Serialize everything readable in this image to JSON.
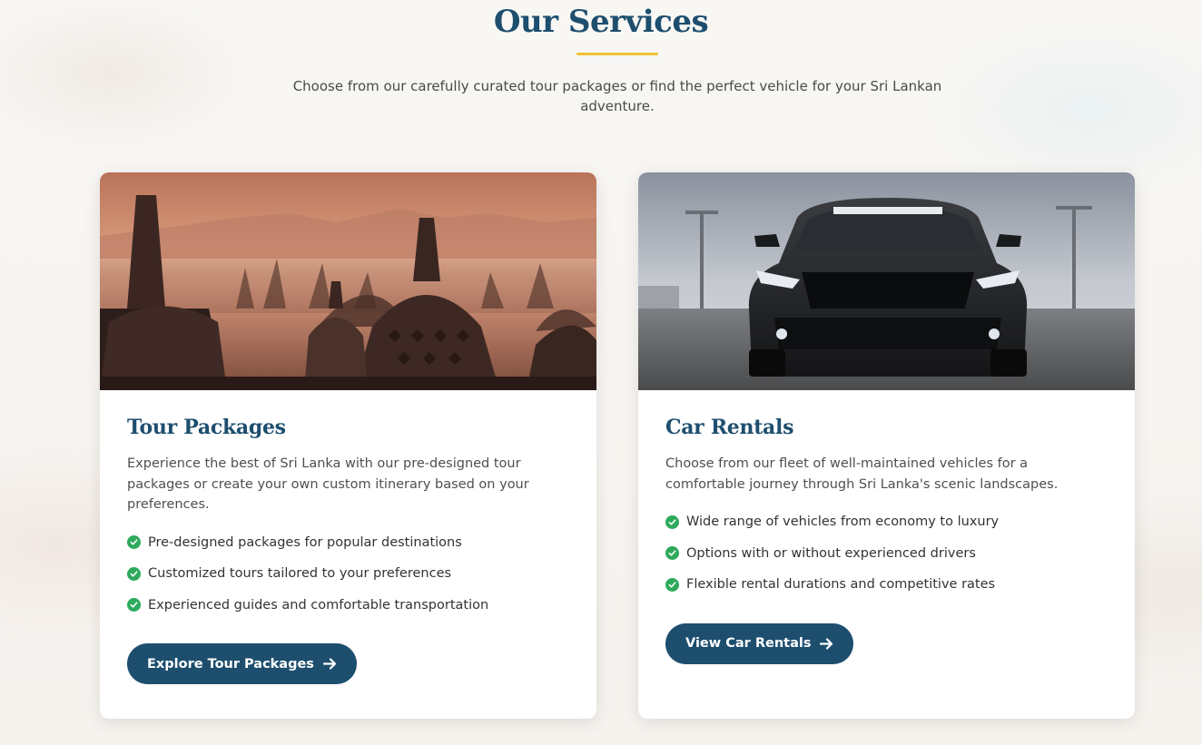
{
  "section": {
    "title": "Our Services",
    "subtitle": "Choose from our carefully curated tour packages or find the perfect vehicle for your Sri Lankan adventure."
  },
  "colors": {
    "primary": "#1d4e6e",
    "accent": "#f2c233",
    "check": "#2eaa5c"
  },
  "cards": [
    {
      "image_alt": "temple-stupas-at-sunrise",
      "title": "Tour Packages",
      "description": "Experience the best of Sri Lanka with our pre-designed tour packages or create your own custom itinerary based on your preferences.",
      "features": [
        "Pre-designed packages for popular destinations",
        "Customized tours tailored to your preferences",
        "Experienced guides and comfortable transportation"
      ],
      "button_label": "Explore Tour Packages",
      "button_icon": "arrow-right-icon"
    },
    {
      "image_alt": "black-sports-car",
      "title": "Car Rentals",
      "description": "Choose from our fleet of well-maintained vehicles for a comfortable journey through Sri Lanka's scenic landscapes.",
      "features": [
        "Wide range of vehicles from economy to luxury",
        "Options with or without experienced drivers",
        "Flexible rental durations and competitive rates"
      ],
      "button_label": "View Car Rentals",
      "button_icon": "arrow-right-icon"
    }
  ]
}
